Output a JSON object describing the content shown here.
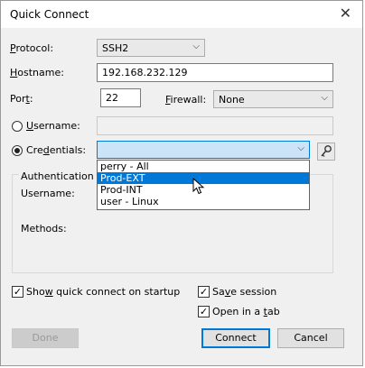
{
  "window": {
    "title": "Quick Connect",
    "close_glyph": "✕"
  },
  "protocol": {
    "label_pre": "",
    "label_u": "P",
    "label_post": "rotocol:",
    "value": "SSH2"
  },
  "hostname": {
    "label_u": "H",
    "label_post": "ostname:",
    "value": "192.168.232.129"
  },
  "port": {
    "label_pre": "Por",
    "label_u": "t",
    "label_post": ":",
    "value": "22"
  },
  "firewall": {
    "label_u": "F",
    "label_post": "irewall:",
    "value": "None"
  },
  "username": {
    "label_u": "U",
    "label_post": "sername:",
    "value": ""
  },
  "credentials": {
    "label_pre": "Cre",
    "label_u": "d",
    "label_post": "entials:",
    "value": ""
  },
  "auth_group": {
    "title": "Authentication",
    "username_label": "Username:",
    "methods_label": "Methods:"
  },
  "dropdown": {
    "options": [
      "perry - All",
      "Prod-EXT",
      "Prod-INT",
      "user - Linux"
    ],
    "selected_index": 1
  },
  "options": {
    "show_quick_connect": {
      "label_pre": "Sho",
      "label_u": "w",
      "label_post": " quick connect on startup",
      "checked": true
    },
    "save_session": {
      "label_pre": "Sa",
      "label_u": "v",
      "label_post": "e session",
      "checked": true
    },
    "open_in_tab": {
      "label_pre": "Open in a ",
      "label_u": "t",
      "label_post": "ab",
      "checked": true
    }
  },
  "buttons": {
    "done": "Done",
    "connect": "Connect",
    "cancel": "Cancel"
  },
  "glyphs": {
    "chevron": "⌵",
    "check": "✓"
  }
}
